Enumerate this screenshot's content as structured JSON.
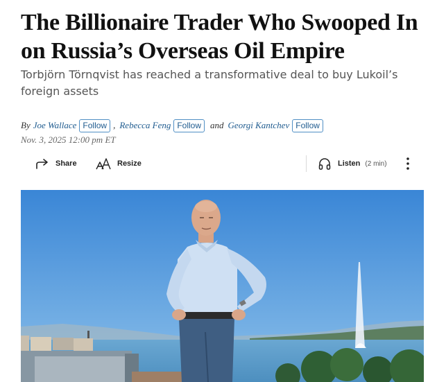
{
  "article": {
    "headline": "The Billionaire Trader Who Swooped In on Russia’s Overseas Oil Empire",
    "dek": "Torbjörn Törnqvist has reached a transformative deal to buy Lukoil’s foreign assets",
    "byline": {
      "by": "By",
      "authors": [
        "Joe Wallace",
        "Rebecca Feng",
        "Georgi Kantchev"
      ],
      "separator": ",",
      "and": "and",
      "follow_label": "Follow"
    },
    "date": "Nov. 3, 2025 12:00 pm ET"
  },
  "toolbar": {
    "share_label": "Share",
    "resize_label": "Resize",
    "listen_label": "Listen",
    "listen_duration": "(2 min)",
    "icons": {
      "share": "share-arrow-icon",
      "resize": "text-resize-icon",
      "listen": "headphones-icon",
      "more": "more-vertical-icon"
    }
  },
  "colors": {
    "link": "#1f5b8f",
    "follow_border": "#4f8ec4",
    "sky": "#3f8fdc",
    "lake": "#5fa0cc"
  }
}
